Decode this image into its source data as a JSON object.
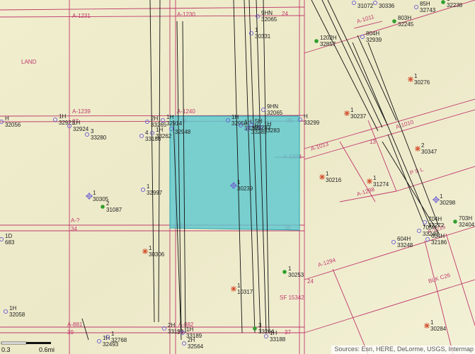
{
  "map": {
    "land_label": "LAND",
    "selection_fill": "#5bc8cf",
    "survey_color": "#c0396b",
    "well_color": "#6d5fd3",
    "green_well_color": "#2e9e2e",
    "red_well_color": "#d24a2a",
    "surveys": [
      "A-1231",
      "A-1230",
      "A-1239",
      "A-1240",
      "A-1011",
      "A-1013",
      "A-1333",
      "A-1010",
      "A-1298",
      "A-1215",
      "A-?",
      "A-1294",
      "A-881",
      "A-882",
      "A-1",
      "PSL",
      "BLK C26",
      "SF 15342",
      "27",
      "26",
      "25",
      "24",
      "24",
      "13",
      "34",
      "35",
      "36",
      "39",
      "38",
      "37",
      "24"
    ],
    "wells": [
      {
        "id": "w1",
        "lbl": "1H",
        "num": "32921",
        "type": "pin"
      },
      {
        "id": "w2",
        "lbl": "1H",
        "num": "32924",
        "type": "pin"
      },
      {
        "id": "w3",
        "lbl": "3",
        "num": "33280",
        "type": "pin"
      },
      {
        "id": "w4",
        "lbl": "2H",
        "num": "33265",
        "type": "pin"
      },
      {
        "id": "w5",
        "lbl": "1H",
        "num": "32914",
        "type": "pin"
      },
      {
        "id": "w6",
        "lbl": "1H",
        "num": "33262",
        "type": "pin"
      },
      {
        "id": "w7",
        "lbl": "",
        "num": "32948",
        "type": "pin"
      },
      {
        "id": "w8",
        "lbl": "4",
        "num": "33186",
        "type": "pin"
      },
      {
        "id": "w9",
        "lbl": "1",
        "num": "32997",
        "type": "pin"
      },
      {
        "id": "w10",
        "lbl": "1",
        "num": "30305",
        "type": "star"
      },
      {
        "id": "w11",
        "lbl": "2",
        "num": "31087",
        "type": "green"
      },
      {
        "id": "w12",
        "lbl": "1",
        "num": "30239",
        "type": "star"
      },
      {
        "id": "w13",
        "lbl": "1",
        "num": "30306",
        "type": "red"
      },
      {
        "id": "w14",
        "lbl": "1",
        "num": "30331",
        "type": "pin"
      },
      {
        "id": "w15",
        "lbl": "9HN",
        "num": "32065",
        "type": "pin"
      },
      {
        "id": "w16",
        "lbl": "9HN",
        "num": "32065",
        "type": "pin"
      },
      {
        "id": "w17",
        "lbl": "1H",
        "num": "32950",
        "type": "pin"
      },
      {
        "id": "w18",
        "lbl": "1H",
        "num": "33286",
        "type": "pin"
      },
      {
        "id": "w19",
        "lbl": "1H",
        "num": "33283",
        "type": "pin"
      },
      {
        "id": "w20",
        "lbl": "H",
        "num": "33299",
        "type": "pin"
      },
      {
        "id": "w21",
        "lbl": "1",
        "num": "30253",
        "type": "green"
      },
      {
        "id": "w22",
        "lbl": "1",
        "num": "10317",
        "type": "red"
      },
      {
        "id": "w23",
        "lbl": "1202H",
        "num": "32857",
        "type": "green"
      },
      {
        "id": "w24",
        "lbl": "804H",
        "num": "32939",
        "type": "pin"
      },
      {
        "id": "w25",
        "lbl": "803H",
        "num": "32245",
        "type": "green"
      },
      {
        "id": "w26",
        "lbl": "1",
        "num": "30276",
        "type": "red"
      },
      {
        "id": "w27",
        "lbl": "1",
        "num": "30237",
        "type": "red"
      },
      {
        "id": "w28",
        "lbl": "2",
        "num": "30347",
        "type": "red"
      },
      {
        "id": "w29",
        "lbl": "1",
        "num": "30216",
        "type": "red"
      },
      {
        "id": "w30",
        "lbl": "1",
        "num": "31274",
        "type": "red"
      },
      {
        "id": "w31",
        "lbl": "1",
        "num": "30298",
        "type": "star"
      },
      {
        "id": "w32",
        "lbl": "604H",
        "num": "33248",
        "type": "pin"
      },
      {
        "id": "w33",
        "lbl": "604H",
        "num": "32186",
        "type": "pin"
      },
      {
        "id": "w34",
        "lbl": "705H",
        "num": "33249",
        "type": "pin"
      },
      {
        "id": "w35",
        "lbl": "704H",
        "num": "32272",
        "type": "pin"
      },
      {
        "id": "w36",
        "lbl": "703H",
        "num": "32404",
        "type": "green"
      },
      {
        "id": "w37",
        "lbl": "1",
        "num": "30284",
        "type": "red"
      },
      {
        "id": "w38",
        "lbl": "",
        "num": "31072",
        "type": "pin"
      },
      {
        "id": "w39",
        "lbl": "",
        "num": "30336",
        "type": "pin"
      },
      {
        "id": "w40",
        "lbl": "85H",
        "num": "32743",
        "type": "pin"
      },
      {
        "id": "w41",
        "lbl": "1",
        "num": "32238",
        "type": "green"
      },
      {
        "id": "w42",
        "lbl": "1H",
        "num": "32058",
        "type": "pin"
      },
      {
        "id": "w43",
        "lbl": "1H",
        "num": "32493",
        "type": "pin"
      },
      {
        "id": "w44",
        "lbl": "1",
        "num": "32768",
        "type": "pin"
      },
      {
        "id": "w45",
        "lbl": "2H",
        "num": "33190",
        "type": "pin"
      },
      {
        "id": "w46",
        "lbl": "1H",
        "num": "33189",
        "type": "pin"
      },
      {
        "id": "w47",
        "lbl": "2H",
        "num": "32564",
        "type": "pin"
      },
      {
        "id": "w48",
        "lbl": "3",
        "num": "33264",
        "type": "green"
      },
      {
        "id": "w49",
        "lbl": "1H",
        "num": "33188",
        "type": "pin"
      },
      {
        "id": "w50",
        "lbl": "1D",
        "num": "683",
        "type": "pin"
      },
      {
        "id": "w51",
        "lbl": "H",
        "num": "32056",
        "type": "pin"
      },
      {
        "id": "w52",
        "lbl": "1H",
        "num": "33281",
        "type": "pin"
      },
      {
        "id": "w53",
        "lbl": "5H",
        "num": "33283",
        "type": "pin"
      }
    ]
  },
  "scale": {
    "left": "0.3",
    "right": "0.6mi"
  },
  "attribution": "Sources: Esri, HERE, DeLorme, USGS, Intermap"
}
